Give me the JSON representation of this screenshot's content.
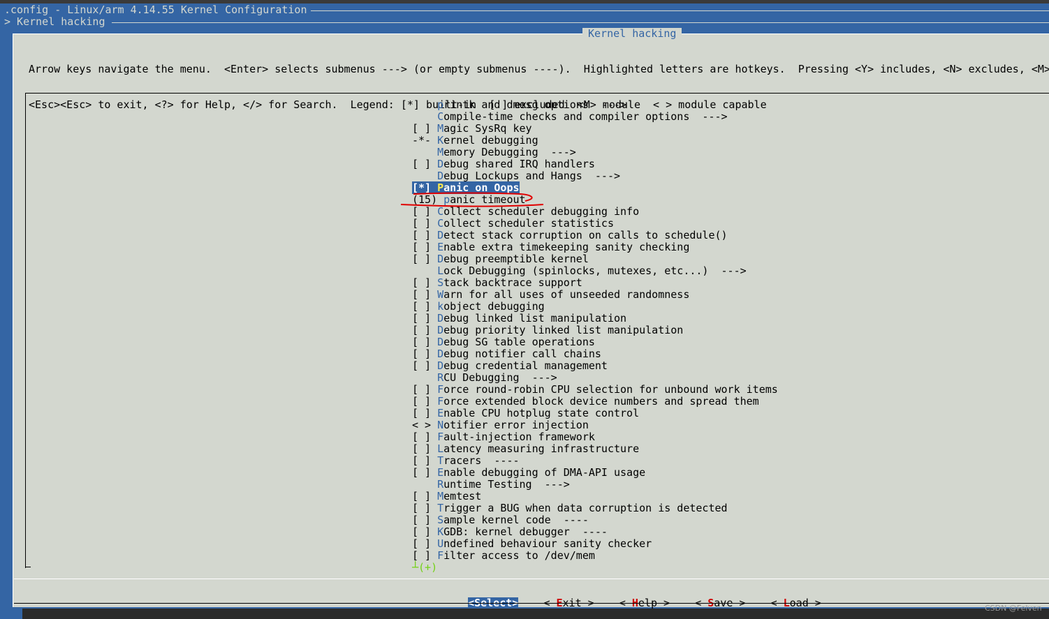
{
  "header": {
    "title": ".config - Linux/arm 4.14.55 Kernel Configuration",
    "breadcrumb": "> Kernel hacking"
  },
  "dialog": {
    "title": "Kernel hacking",
    "help_line1": "Arrow keys navigate the menu.  <Enter> selects submenus ---> (or empty submenus ----).  Highlighted letters are hotkeys.  Pressing <Y> includes, <N> excludes, <M>",
    "help_line2": "<Esc><Esc> to exit, <?> for Help, </> for Search.  Legend: [*] built-in  [ ] excluded  <M> module  < > module capable"
  },
  "menu": {
    "items": [
      {
        "prefix": "    ",
        "hotkey": "p",
        "rest": "rintk and dmesg options  --->",
        "selected": false
      },
      {
        "prefix": "    ",
        "hotkey": "C",
        "rest": "ompile-time checks and compiler options  --->",
        "selected": false
      },
      {
        "prefix": "[ ] ",
        "hotkey": "M",
        "rest": "agic SysRq key",
        "selected": false
      },
      {
        "prefix": "-*- ",
        "hotkey": "K",
        "rest": "ernel debugging",
        "selected": false
      },
      {
        "prefix": "    ",
        "hotkey": "M",
        "rest": "emory Debugging  --->",
        "selected": false
      },
      {
        "prefix": "[ ] ",
        "hotkey": "D",
        "rest": "ebug shared IRQ handlers",
        "selected": false
      },
      {
        "prefix": "    ",
        "hotkey": "D",
        "rest": "ebug Lockups and Hangs  --->",
        "selected": false
      },
      {
        "prefix": "[*] ",
        "hotkey": "P",
        "rest": "anic on Oops",
        "selected": true
      },
      {
        "prefix": "(15) ",
        "hotkey": "p",
        "rest": "anic timeout",
        "selected": false
      },
      {
        "prefix": "[ ] ",
        "hotkey": "C",
        "rest": "ollect scheduler debugging info",
        "selected": false
      },
      {
        "prefix": "[ ] ",
        "hotkey": "C",
        "rest": "ollect scheduler statistics",
        "selected": false
      },
      {
        "prefix": "[ ] ",
        "hotkey": "D",
        "rest": "etect stack corruption on calls to schedule()",
        "selected": false
      },
      {
        "prefix": "[ ] ",
        "hotkey": "E",
        "rest": "nable extra timekeeping sanity checking",
        "selected": false
      },
      {
        "prefix": "[ ] ",
        "hotkey": "D",
        "rest": "ebug preemptible kernel",
        "selected": false
      },
      {
        "prefix": "    ",
        "hotkey": "L",
        "rest": "ock Debugging (spinlocks, mutexes, etc...)  --->",
        "selected": false
      },
      {
        "prefix": "[ ] ",
        "hotkey": "S",
        "rest": "tack backtrace support",
        "selected": false
      },
      {
        "prefix": "[ ] ",
        "hotkey": "W",
        "rest": "arn for all uses of unseeded randomness",
        "selected": false
      },
      {
        "prefix": "[ ] ",
        "hotkey": "k",
        "rest": "object debugging",
        "selected": false
      },
      {
        "prefix": "[ ] ",
        "hotkey": "D",
        "rest": "ebug linked list manipulation",
        "selected": false
      },
      {
        "prefix": "[ ] ",
        "hotkey": "D",
        "rest": "ebug priority linked list manipulation",
        "selected": false
      },
      {
        "prefix": "[ ] ",
        "hotkey": "D",
        "rest": "ebug SG table operations",
        "selected": false
      },
      {
        "prefix": "[ ] ",
        "hotkey": "D",
        "rest": "ebug notifier call chains",
        "selected": false
      },
      {
        "prefix": "[ ] ",
        "hotkey": "D",
        "rest": "ebug credential management",
        "selected": false
      },
      {
        "prefix": "    ",
        "hotkey": "R",
        "rest": "CU Debugging  --->",
        "selected": false
      },
      {
        "prefix": "[ ] ",
        "hotkey": "F",
        "rest": "orce round-robin CPU selection for unbound work items",
        "selected": false
      },
      {
        "prefix": "[ ] ",
        "hotkey": "F",
        "rest": "orce extended block device numbers and spread them",
        "selected": false
      },
      {
        "prefix": "[ ] ",
        "hotkey": "E",
        "rest": "nable CPU hotplug state control",
        "selected": false
      },
      {
        "prefix": "< > ",
        "hotkey": "N",
        "rest": "otifier error injection",
        "selected": false
      },
      {
        "prefix": "[ ] ",
        "hotkey": "F",
        "rest": "ault-injection framework",
        "selected": false
      },
      {
        "prefix": "[ ] ",
        "hotkey": "L",
        "rest": "atency measuring infrastructure",
        "selected": false
      },
      {
        "prefix": "[ ] ",
        "hotkey": "T",
        "rest": "racers  ----",
        "selected": false
      },
      {
        "prefix": "[ ] ",
        "hotkey": "E",
        "rest": "nable debugging of DMA-API usage",
        "selected": false
      },
      {
        "prefix": "    ",
        "hotkey": "R",
        "rest": "untime Testing  --->",
        "selected": false
      },
      {
        "prefix": "[ ] ",
        "hotkey": "M",
        "rest": "emtest",
        "selected": false
      },
      {
        "prefix": "[ ] ",
        "hotkey": "T",
        "rest": "rigger a BUG when data corruption is detected",
        "selected": false
      },
      {
        "prefix": "[ ] ",
        "hotkey": "S",
        "rest": "ample kernel code  ----",
        "selected": false
      },
      {
        "prefix": "[ ] ",
        "hotkey": "K",
        "rest": "GDB: kernel debugger  ----",
        "selected": false
      },
      {
        "prefix": "[ ] ",
        "hotkey": "U",
        "rest": "ndefined behaviour sanity checker",
        "selected": false
      },
      {
        "prefix": "[ ] ",
        "hotkey": "F",
        "rest": "ilter access to /dev/mem",
        "selected": false
      }
    ],
    "more_indicator": "┴(+)"
  },
  "buttons": {
    "select": "<Select>",
    "exit": {
      "open": "< ",
      "hotkey": "E",
      "rest": "xit",
      "close": " >"
    },
    "help": {
      "open": "< ",
      "hotkey": "H",
      "rest": "elp",
      "close": " >"
    },
    "save": {
      "open": "< ",
      "hotkey": "S",
      "rest": "ave",
      "close": " >"
    },
    "load": {
      "open": "< ",
      "hotkey": "L",
      "rest": "oad",
      "close": " >"
    }
  },
  "watermark": "CSDN @Felven",
  "colors": {
    "background": "#3465a4",
    "dialog": "#d3d7cf",
    "hotkey": "#3465a4",
    "button_hotkey": "#cc0000",
    "annotation": "#e00000"
  }
}
